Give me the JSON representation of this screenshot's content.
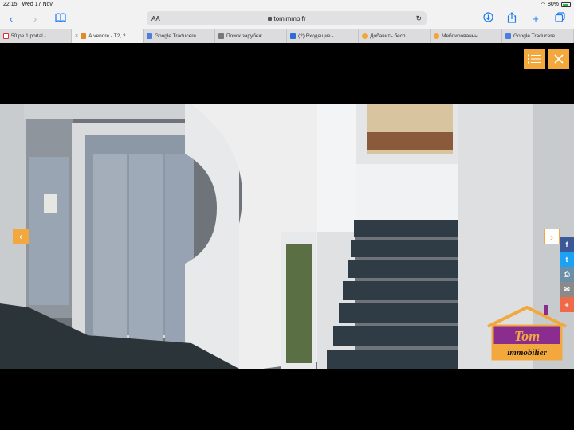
{
  "status": {
    "time": "22:15",
    "date": "Wed 17 Nov",
    "battery": "80%"
  },
  "toolbar": {
    "text_size": "AA",
    "url": "tomimmo.fr"
  },
  "tabs": [
    {
      "label": "50 ре 1 portal -...",
      "icon": "gmail-icon",
      "active": false
    },
    {
      "label": "À vendre - T2, 2...",
      "icon": "home-icon",
      "active": true
    },
    {
      "label": "Google Traducere",
      "icon": "translate-icon",
      "active": false
    },
    {
      "label": "Поиск зарубеж...",
      "icon": "search-icon",
      "active": false
    },
    {
      "label": "(2) Входящие -...",
      "icon": "mail-icon",
      "active": false
    },
    {
      "label": "Добавить бесп...",
      "icon": "orange-icon",
      "active": false
    },
    {
      "label": "Меблированны...",
      "icon": "orange-icon",
      "active": false
    },
    {
      "label": "Google Traducere",
      "icon": "translate-icon",
      "active": false
    }
  ],
  "page": {
    "accent": "#f2a83c",
    "list_icon": "list-icon",
    "close_icon": "close-icon",
    "prev_arrow": "‹",
    "next_arrow": "›",
    "logo": {
      "line1": "Tom",
      "line2": "immobilier"
    },
    "share": [
      {
        "name": "facebook-icon",
        "glyph": "f",
        "color": "#3b5998"
      },
      {
        "name": "twitter-icon",
        "glyph": "t",
        "color": "#1da1f2"
      },
      {
        "name": "print-icon",
        "glyph": "⎙",
        "color": "#6c8fa8"
      },
      {
        "name": "email-icon",
        "glyph": "✉",
        "color": "#8a8a8a"
      },
      {
        "name": "more-icon",
        "glyph": "+",
        "color": "#f06a4a"
      }
    ]
  }
}
